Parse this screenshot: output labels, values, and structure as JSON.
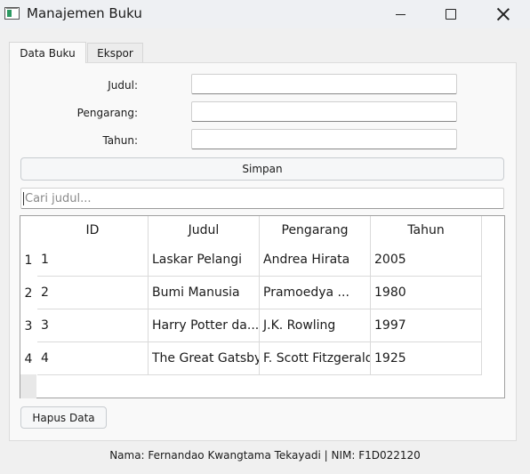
{
  "window": {
    "title": "Manajemen Buku"
  },
  "tabs": [
    {
      "label": "Data Buku",
      "active": true
    },
    {
      "label": "Ekspor",
      "active": false
    }
  ],
  "form": {
    "judul_label": "Judul:",
    "pengarang_label": "Pengarang:",
    "tahun_label": "Tahun:",
    "judul_value": "",
    "pengarang_value": "",
    "tahun_value": "",
    "save_label": "Simpan"
  },
  "search": {
    "placeholder": "Cari judul..."
  },
  "table": {
    "headers": [
      "ID",
      "Judul",
      "Pengarang",
      "Tahun"
    ],
    "row_numbers": [
      "1",
      "2",
      "3",
      "4"
    ],
    "rows": [
      [
        "1",
        "Laskar Pelangi",
        "Andrea Hirata",
        "2005"
      ],
      [
        "2",
        "Bumi Manusia",
        "Pramoedya ...",
        "1980"
      ],
      [
        "3",
        "Harry Potter da...",
        "J.K. Rowling",
        "1997"
      ],
      [
        "4",
        "The Great Gatsby",
        "F. Scott Fitzgerald",
        "1925"
      ]
    ]
  },
  "actions": {
    "delete_label": "Hapus Data"
  },
  "footer": {
    "text": "Nama: Fernandao Kwangtama Tekayadi | NIM: F1D022120"
  }
}
